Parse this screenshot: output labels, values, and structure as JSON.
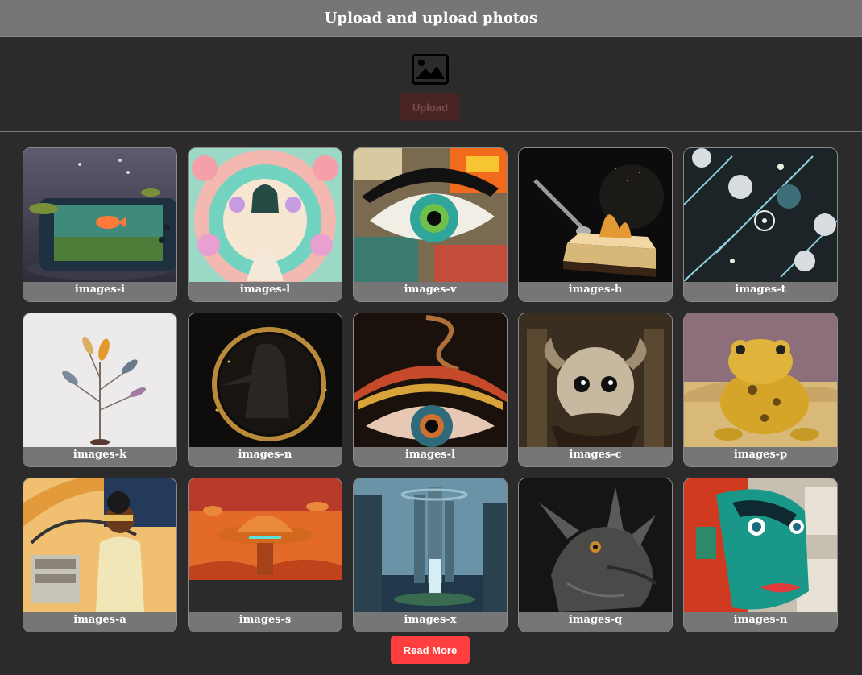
{
  "header": {
    "title": "Upload and upload photos"
  },
  "upload": {
    "icon": "image-icon",
    "button_label": "Upload"
  },
  "gallery": {
    "items": [
      {
        "caption": "images-i",
        "image": "fish-aquarium-console"
      },
      {
        "caption": "images-l",
        "image": "floral-doll-mandala"
      },
      {
        "caption": "images-v",
        "image": "colorful-eye-collage"
      },
      {
        "caption": "images-h",
        "image": "cake-slice-spoon"
      },
      {
        "caption": "images-t",
        "image": "geometric-pattern"
      },
      {
        "caption": "images-k",
        "image": "autumn-sapling"
      },
      {
        "caption": "images-n",
        "image": "hooded-figure-moon"
      },
      {
        "caption": "images-l",
        "image": "ornate-eye"
      },
      {
        "caption": "images-c",
        "image": "fluffy-creature"
      },
      {
        "caption": "images-p",
        "image": "yellow-frog-desert"
      },
      {
        "caption": "images-a",
        "image": "comic-pilot-woman"
      },
      {
        "caption": "images-s",
        "image": "ufo-alien-landscape"
      },
      {
        "caption": "images-x",
        "image": "fantasy-waterfall-city"
      },
      {
        "caption": "images-q",
        "image": "dragon-head"
      },
      {
        "caption": "images-n",
        "image": "collage-face"
      }
    ]
  },
  "actions": {
    "read_more_label": "Read More"
  },
  "colors": {
    "background": "#2b2b2b",
    "header": "#767676",
    "accent": "#ff3f3f",
    "upload_disabled": "#4a2424"
  }
}
